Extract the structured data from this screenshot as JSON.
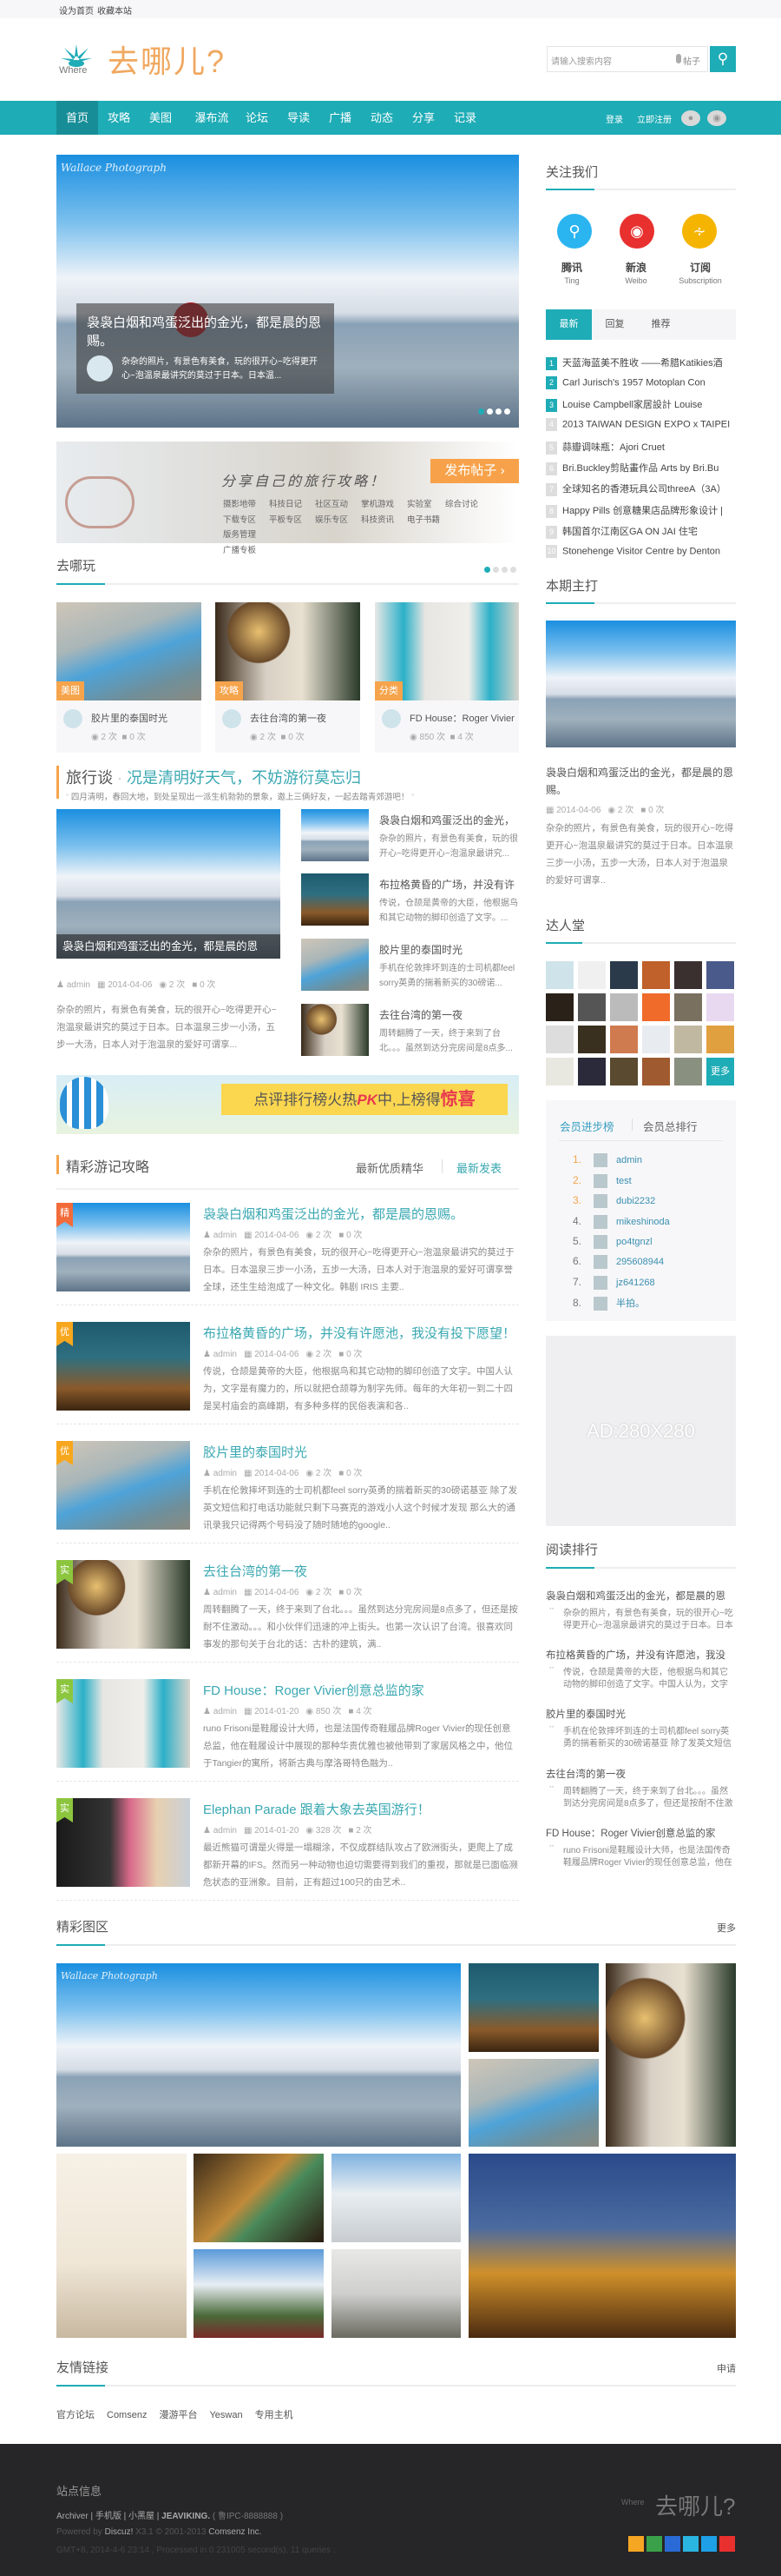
{
  "topbar": {
    "set_home": "设为首页",
    "bookmark": "收藏本站"
  },
  "logo": {
    "sub": "Where",
    "text": "去哪儿?"
  },
  "search": {
    "placeholder": "请输入搜索内容",
    "type": "帖子"
  },
  "nav": {
    "items": [
      "首页",
      "攻略",
      "美图",
      "瀑布流",
      "论坛",
      "导读",
      "广播",
      "动态",
      "分享",
      "记录"
    ],
    "login": "登录",
    "register": "立即注册"
  },
  "slider": {
    "watermark": "Wallace Photograph",
    "title": "袅袅白烟和鸡蛋泛出的金光，都是晨的恩赐。",
    "quote": "杂杂的照片，有景色有美食，玩的很开心~吃得更开心~泡温泉最讲究的莫过于日本。日本温..."
  },
  "share": {
    "slogan": "分享自己的旅行攻略！",
    "button": "发布帖子 ›",
    "categories": [
      "摄影地带",
      "科技日记",
      "社区互动",
      "掌机游戏",
      "实验室",
      "综合讨论",
      "下载专区",
      "平板专区",
      "娱乐专区",
      "科技资讯",
      "电子书籍",
      "版务管理",
      "广播专板"
    ]
  },
  "play": {
    "title": "去哪玩",
    "cards": [
      {
        "tag": "美图",
        "title": "胶片里的泰国时光",
        "views": "2 次",
        "replies": "0 次"
      },
      {
        "tag": "攻略",
        "title": "去往台湾的第一夜",
        "views": "2 次",
        "replies": "0 次"
      },
      {
        "tag": "分类",
        "title": "FD House：Roger Vivier",
        "views": "850 次",
        "replies": "4 次"
      }
    ]
  },
  "talk": {
    "label": "旅行谈",
    "headline": "况是清明好天气，不妨游衍莫忘归",
    "quote": "四月清明，春回大地，到处呈现出一派生机勃勃的景象，邀上三俩好友，一起去踏青郊游吧！",
    "main": {
      "caption": "袅袅白烟和鸡蛋泛出的金光，都是晨的恩",
      "author": "admin",
      "date": "2014-04-06",
      "views": "2 次",
      "replies": "0 次",
      "desc": "杂杂的照片，有景色有美食，玩的很开心~吃得更开心~泡温泉最讲究的莫过于日本。日本温泉三步一小汤，五步一大汤，日本人对于泡温泉的爱好可谓享..."
    },
    "items": [
      {
        "title": "袅袅白烟和鸡蛋泛出的金光，",
        "desc": "杂杂的照片，有景色有美食，玩的很开心~吃得更开心~泡温泉最讲究..."
      },
      {
        "title": "布拉格黄昏的广场，并没有许",
        "desc": "传说，仓颉是黄帝的大臣，他根据鸟和其它动物的脚印创造了文字。..."
      },
      {
        "title": "胶片里的泰国时光",
        "desc": "手机在伦敦摔坏到连的士司机都feel sorry英勇的揣着新买的30磅诺..."
      },
      {
        "title": "去往台湾的第一夜",
        "desc": "周转翻腾了一天，终于来到了台北。。。虽然到达分完房间是8点多..."
      }
    ]
  },
  "adbanner": {
    "text1": "点评排行榜火热",
    "pk": "PK",
    "text2": "中,上榜得",
    "surprise": "惊喜"
  },
  "travel": {
    "title": "精彩游记攻略",
    "tab1": "最新优质精华",
    "tab2": "最新发表",
    "articles": [
      {
        "badge": "精",
        "title": "袅袅白烟和鸡蛋泛出的金光，都是晨的恩赐。",
        "author": "admin",
        "date": "2014-04-06",
        "views": "2 次",
        "replies": "0 次",
        "desc": "杂杂的照片，有景色有美食，玩的很开心~吃得更开心~泡温泉最讲究的莫过于日本。日本温泉三步一小汤，五步一大汤，日本人对于泡温泉的爱好可谓享誉全球，还生生给泡成了一种文化。韩剧 IRIS 主要.."
      },
      {
        "badge": "优",
        "title": "布拉格黄昏的广场，并没有许愿池，我没有投下愿望！",
        "author": "admin",
        "date": "2014-04-06",
        "views": "2 次",
        "replies": "0 次",
        "desc": "传说，仓颉是黄帝的大臣，他根据鸟和其它动物的脚印创造了文字。中国人认为，文字是有魔力的，所以就把仓颉尊为制字先师。每年的大年初一到二十四是吴村庙会的高峰期，有多种多样的民俗表演和各.."
      },
      {
        "badge": "优",
        "title": "胶片里的泰国时光",
        "author": "admin",
        "date": "2014-04-06",
        "views": "2 次",
        "replies": "0 次",
        "desc": "手机在伦敦摔坏到连的士司机都feel sorry英勇的揣着新买的30磅诺基亚 除了发英文短信和打电话功能就只剩下马赛克的游戏小人这个时候才发现 那么大的通讯录我只记得两个号码没了随时随地的google.."
      },
      {
        "badge": "实",
        "title": "去往台湾的第一夜",
        "author": "admin",
        "date": "2014-04-06",
        "views": "2 次",
        "replies": "0 次",
        "desc": "周转翻腾了一天，终于来到了台北。。。虽然到达分完房间是8点多了，但还是按耐不住激动。。。和小伙伴们迅速的冲上街头。也第一次认识了台湾。很喜欢同事发的那句关于台北的话：古朴的建筑，满.."
      },
      {
        "badge": "实",
        "title": "FD House：Roger Vivier创意总监的家",
        "author": "admin",
        "date": "2014-01-20",
        "views": "850 次",
        "replies": "4 次",
        "desc": "runo Frisoni是鞋履设计大师，也是法国传奇鞋履品牌Roger Vivier的现任创意总监，他在鞋履设计中展现的那种华贵优雅也被他带到了家居风格之中，他位于Tangier的寓所，将新古典与摩洛哥特色融为.."
      },
      {
        "badge": "实",
        "title": "Elephan Parade 跟着大象去英国游行！",
        "author": "admin",
        "date": "2014-01-20",
        "views": "328 次",
        "replies": "2 次",
        "desc": "最近熊猫可谓是火得是一塌糊涂，不仅成群结队攻占了欧洲街头，更爬上了成都新开幕的IFS。然而另一种动物也迫切需要得到我们的重视，那就是已面临濒危状态的亚洲象。目前，正有超过100只的由艺术.."
      }
    ]
  },
  "gallery": {
    "title": "精彩图区",
    "more": "更多",
    "watermark": "Wallace Photograph"
  },
  "links": {
    "title": "友情链接",
    "apply": "申请",
    "items": [
      "官方论坛",
      "Comsenz",
      "漫游平台",
      "Yeswan",
      "专用主机"
    ]
  },
  "sidebar": {
    "follow": {
      "title": "关注我们",
      "items": [
        {
          "name": "腾讯",
          "sub": "Ting"
        },
        {
          "name": "新浪",
          "sub": "Weibo"
        },
        {
          "name": "订阅",
          "sub": "Subscription"
        }
      ]
    },
    "tabs": [
      "最新",
      "回复",
      "推荐"
    ],
    "latest": [
      "天蓝海蓝美不胜收 ——希腊Katikies酒",
      "Carl Jurisch's 1957 Motoplan Con",
      "Louise Campbell家居設計 Louise",
      "2013 TAIWAN DESIGN EXPO x TAIPEI",
      "蒜瓣调味瓶：Ajori Cruet",
      "Bri.Buckley剪貼畫作品 Arts by Bri.Bu",
      "全球知名的香港玩具公司threeA（3A）",
      "Happy Pills 创意糖果店品牌形象设计 |",
      "韩国首尔江南区GA ON JAI 住宅",
      "Stonehenge Visitor Centre by Denton"
    ],
    "feature": {
      "title": "本期主打",
      "headline": "袅袅白烟和鸡蛋泛出的金光，都是晨的恩赐。",
      "date": "2014-04-06",
      "views": "2 次",
      "replies": "0 次",
      "desc": "杂杂的照片，有景色有美食，玩的很开心~吃得更开心~泡温泉最讲究的莫过于日本。日本温泉三步一小汤，五步一大汤，日本人对于泡温泉的爱好可谓享.."
    },
    "experts": {
      "title": "达人堂",
      "more": "更多"
    },
    "members": {
      "tab1": "会员进步榜",
      "tab2": "会员总排行",
      "list": [
        "admin",
        "test",
        "dubi2232",
        "mikeshinoda",
        "po4tgnzl",
        "295608944",
        "jz641268",
        "半拍。"
      ]
    },
    "ad": "AD:280X280",
    "reading": {
      "title": "阅读排行",
      "items": [
        {
          "title": "袅袅白烟和鸡蛋泛出的金光，都是晨的恩",
          "desc": "杂杂的照片，有景色有美食，玩的很开心~吃得更开心~泡温泉最讲究的莫过于日本。日本温"
        },
        {
          "title": "布拉格黄昏的广场，并没有许愿池，我没",
          "desc": "传说，仓颉是黄帝的大臣，他根据鸟和其它动物的脚印创造了文字。中国人认为，文字是有"
        },
        {
          "title": "胶片里的泰国时光",
          "desc": "手机在伦敦摔坏到连的士司机都feel sorry英勇的揣着新买的30磅诺基亚 除了发英文短信"
        },
        {
          "title": "去往台湾的第一夜",
          "desc": "周转翻腾了一天，终于来到了台北。。。虽然到达分完房间是8点多了，但还是按耐不住激"
        },
        {
          "title": "FD House：Roger Vivier创意总监的家",
          "desc": "runo Frisoni是鞋履设计大师，也是法国传奇鞋履品牌Roger Vivier的现任创意总监，他在"
        }
      ]
    }
  },
  "footer": {
    "title": "站点信息",
    "links": [
      "Archiver",
      "手机版",
      "小黑屋",
      "JEAVIKING."
    ],
    "icp": "( 鲁IPC-8888888 )",
    "powered": "Powered by",
    "discuz": "Discuz!",
    "version": "X3.1 © 2001-2013",
    "comsenz": "Comsenz Inc.",
    "stats": "GMT+8, 2014-4-6 23:14 , Processed in 0.231005 second(s), 11 queries ."
  },
  "colors": {
    "brand": "#1eacb6",
    "accent": "#f6a44c",
    "logo": "#f0a860",
    "footer": "#262628"
  }
}
